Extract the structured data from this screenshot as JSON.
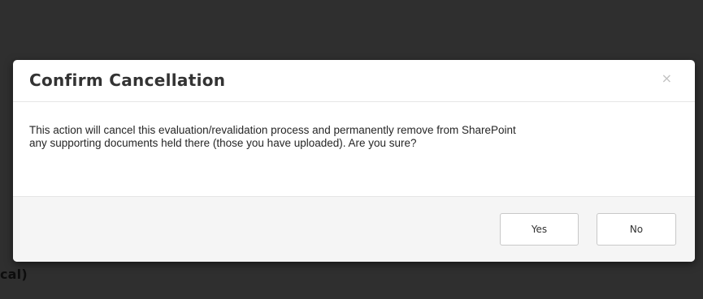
{
  "background": {
    "partial_text": "cal)"
  },
  "dialog": {
    "title": "Confirm Cancellation",
    "close_glyph": "×",
    "close_icon": "close-icon",
    "message": "This action will cancel this evaluation/revalidation process and permanently remove from SharePoint any supporting documents held there (those you have uploaded). Are you sure?",
    "buttons": {
      "yes_label": "Yes",
      "no_label": "No"
    }
  },
  "colors": {
    "overlay": "#2f2f2f",
    "dialog_background": "#ffffff",
    "footer_background": "#f5f5f5",
    "title_text": "#333333"
  }
}
